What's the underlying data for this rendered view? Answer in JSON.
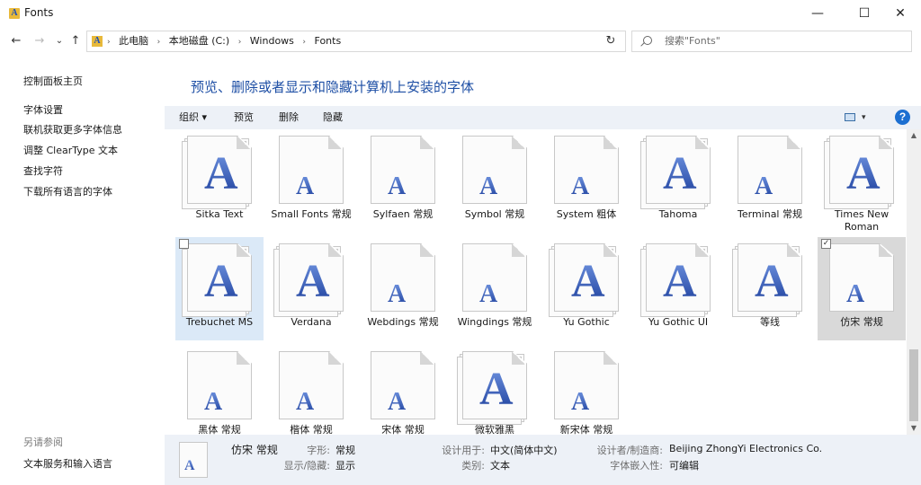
{
  "window": {
    "title": "Fonts",
    "minimize": "—",
    "maximize": "☐",
    "close": "✕"
  },
  "nav": {
    "back": "←",
    "forward": "→",
    "recent": "⌄",
    "up": "↑",
    "crumbs": [
      "此电脑",
      "本地磁盘 (C:)",
      "Windows",
      "Fonts"
    ],
    "crumb_sep": "›",
    "dropdown": "⌄",
    "refresh": "↻",
    "search_placeholder": "搜索\"Fonts\""
  },
  "left_pane": {
    "home": "控制面板主页",
    "links": [
      "字体设置",
      "联机获取更多字体信息",
      "调整 ClearType 文本",
      "查找字符",
      "下载所有语言的字体"
    ],
    "see_also": "另请参阅",
    "see_also_links": [
      "文本服务和输入语言"
    ]
  },
  "heading": "预览、删除或者显示和隐藏计算机上安装的字体",
  "toolbar": {
    "organize": "组织 ▾",
    "preview": "预览",
    "delete": "删除",
    "hide": "隐藏",
    "view_drop": "▾",
    "help": "?"
  },
  "fonts": [
    {
      "label": "Sitka Text",
      "family": true
    },
    {
      "label": "Small Fonts 常规",
      "family": false
    },
    {
      "label": "Sylfaen 常规",
      "family": false
    },
    {
      "label": "Symbol 常规",
      "family": false
    },
    {
      "label": "System 粗体",
      "family": false
    },
    {
      "label": "Tahoma",
      "family": true
    },
    {
      "label": "Terminal 常规",
      "family": false
    },
    {
      "label": "Times New Roman",
      "family": true
    },
    {
      "label": "Trebuchet MS",
      "family": true,
      "state": "hover"
    },
    {
      "label": "Verdana",
      "family": true
    },
    {
      "label": "Webdings 常规",
      "family": false
    },
    {
      "label": "Wingdings 常规",
      "family": false
    },
    {
      "label": "Yu Gothic",
      "family": true
    },
    {
      "label": "Yu Gothic UI",
      "family": true
    },
    {
      "label": "等线",
      "family": true
    },
    {
      "label": "仿宋 常规",
      "family": false,
      "state": "selected"
    },
    {
      "label": "黑体 常规",
      "family": false
    },
    {
      "label": "楷体 常规",
      "family": false
    },
    {
      "label": "宋体 常规",
      "family": false
    },
    {
      "label": "微软雅黑",
      "family": true
    },
    {
      "label": "新宋体 常规",
      "family": false
    }
  ],
  "glyph": "A",
  "scroll": {
    "up": "▲",
    "down": "▼"
  },
  "details": {
    "name": "仿宋 常规",
    "style_label": "字形:",
    "style_value": "常规",
    "visibility_label": "显示/隐藏:",
    "visibility_value": "显示",
    "designed_for_label": "设计用于:",
    "designed_for_value": "中文(简体中文)",
    "category_label": "类别:",
    "category_value": "文本",
    "designer_label": "设计者/制造商:",
    "designer_value": "Beijing ZhongYi Electronics Co.",
    "embed_label": "字体嵌入性:",
    "embed_value": "可编辑"
  }
}
